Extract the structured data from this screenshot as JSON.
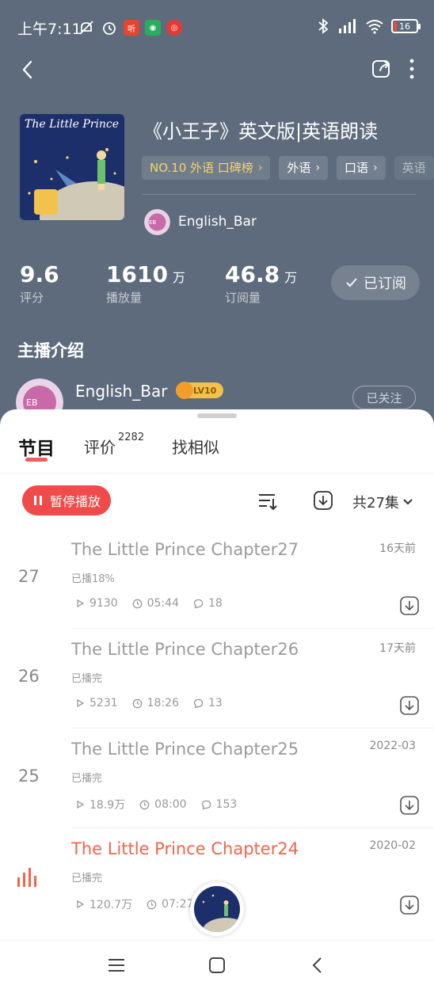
{
  "status_bar": {
    "time": "上午7:11",
    "battery": "16"
  },
  "album": {
    "cover_text": "The Little Prince",
    "title": "《小王子》英文版|英语朗读",
    "tags": [
      {
        "label": "NO.10 外语 口碑榜",
        "kind": "rank"
      },
      {
        "label": "外语"
      },
      {
        "label": "口语"
      },
      {
        "label": "英语"
      }
    ],
    "author": "English_Bar"
  },
  "stats": [
    {
      "value": "9.6",
      "unit": "",
      "label": "评分"
    },
    {
      "value": "1610",
      "unit": "万",
      "label": "播放量"
    },
    {
      "value": "46.8",
      "unit": "万",
      "label": "订阅量"
    }
  ],
  "subscribe_button": "已订阅",
  "host": {
    "heading": "主播介绍",
    "name": "English_Bar",
    "level": "LV10",
    "follow_button": "已关注"
  },
  "tabs": [
    {
      "label": "节目",
      "badge": ""
    },
    {
      "label": "评价",
      "badge": "2282"
    },
    {
      "label": "找相似",
      "badge": ""
    }
  ],
  "toolbar": {
    "pause_label": "暂停播放",
    "episode_count": "共27集"
  },
  "episodes": [
    {
      "number": "27",
      "title": "The Little Prince Chapter27",
      "date": "16天前",
      "progress": "已播18%",
      "plays": "9130",
      "duration": "05:44",
      "comments": "18"
    },
    {
      "number": "26",
      "title": "The Little Prince Chapter26",
      "date": "17天前",
      "progress": "已播完",
      "plays": "5231",
      "duration": "18:26",
      "comments": "13"
    },
    {
      "number": "25",
      "title": "The Little Prince Chapter25",
      "date": "2022-03",
      "progress": "已播完",
      "plays": "18.9万",
      "duration": "08:00",
      "comments": "153"
    },
    {
      "number": "24",
      "title": "The Little Prince Chapter24",
      "date": "2020-02",
      "progress": "已播完",
      "plays": "120.7万",
      "duration": "07:27",
      "comments": ""
    }
  ],
  "colors": {
    "header_bg": "#5d6b7c",
    "accent_red": "#f04a4a",
    "playing_title": "#f0654a",
    "rank_tag": "#f7d36a",
    "level_badge": "#f3c24d"
  }
}
